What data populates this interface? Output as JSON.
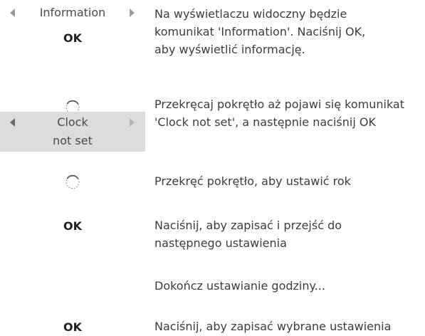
{
  "steps": [
    {
      "display_label": "Information",
      "ok_label": "OK",
      "description": "Na wyświetlaczu widoczny będzie\nkomunikat 'Information'. Naciśnij OK,\naby wyświetlić informację."
    },
    {
      "icon": "rotary-dial-icon",
      "display_line1": "Clock",
      "display_line2": "not set",
      "description": "Przekręcaj pokrętło aż pojawi się komunikat\n'Clock not set', a następnie naciśnij OK"
    },
    {
      "icon": "rotary-dial-icon",
      "description": "Przekręć pokrętło, aby ustawić rok"
    },
    {
      "ok_label": "OK",
      "description": "Naciśnij, aby zapisać i przejść do\nnastępnego ustawienia"
    },
    {
      "description": "Dokończ ustawianie godziny..."
    },
    {
      "ok_label": "OK",
      "description": "Naciśnij, aby zapisać wybrane ustawienia"
    }
  ],
  "colors": {
    "display_background": "#dcdcdc",
    "text": "#3c3c3c",
    "arrow": "#9a9a9a"
  }
}
